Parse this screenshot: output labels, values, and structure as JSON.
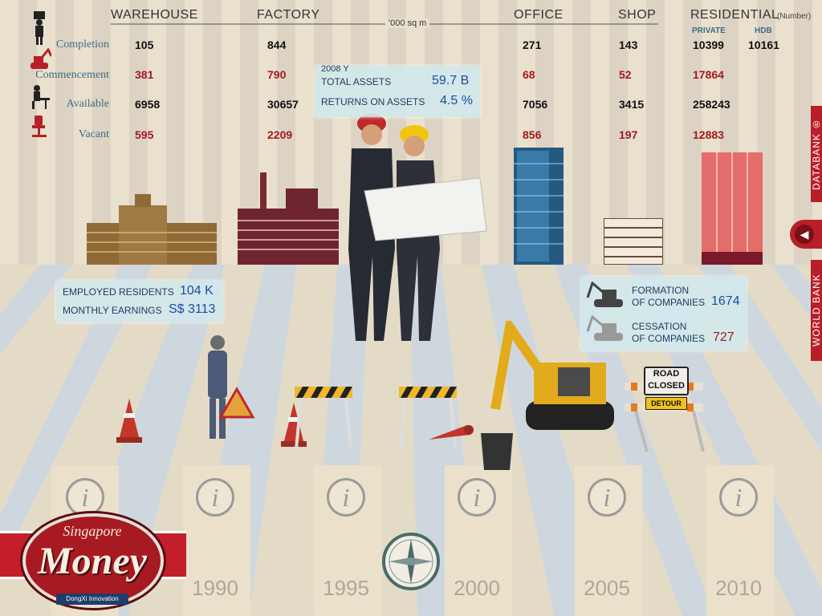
{
  "columns": [
    {
      "key": "warehouse",
      "header": "WAREHOUSE"
    },
    {
      "key": "factory",
      "header": "FACTORY"
    },
    {
      "key": "office",
      "header": "OFFICE"
    },
    {
      "key": "shop",
      "header": "SHOP"
    },
    {
      "key": "residential",
      "header": "RESIDENTIAL",
      "suffix": "(Number)",
      "sub": [
        "PRIVATE",
        "HDB"
      ]
    }
  ],
  "units": "'000 sq m",
  "rows": [
    {
      "label": "Completion",
      "icon": "office-worker-icon",
      "values": [
        "105",
        "844",
        "271",
        "143",
        "10399",
        "10161"
      ],
      "color": "#111"
    },
    {
      "label": "Commencement",
      "icon": "excavator-icon",
      "values": [
        "381",
        "790",
        "68",
        "52",
        "17864"
      ],
      "color": "#a3191f"
    },
    {
      "label": "Available",
      "icon": "desk-worker-icon",
      "values": [
        "6958",
        "30657",
        "7056",
        "3415",
        "258243"
      ],
      "color": "#111"
    },
    {
      "label": "Vacant",
      "icon": "empty-chair-icon",
      "values": [
        "595",
        "2209",
        "856",
        "197",
        "12883"
      ],
      "color": "#a3191f"
    }
  ],
  "assets_panel": {
    "year": "2008 Y",
    "total_assets_label": "TOTAL ASSETS",
    "total_assets": "59.7 B",
    "roa_label": "RETURNS ON ASSETS",
    "roa": "4.5 %"
  },
  "employment_panel": {
    "employed_label": "EMPLOYED RESIDENTS",
    "employed": "104 K",
    "earnings_label": "MONTHLY EARNINGS",
    "earnings": "S$ 3113"
  },
  "companies_panel": {
    "formation_label_1": "FORMATION",
    "formation_label_2": "OF COMPANIES",
    "formation": "1674",
    "cessation_label_1": "CESSATION",
    "cessation_label_2": "OF COMPANIES",
    "cessation": "727"
  },
  "road_sign": {
    "line1": "ROAD",
    "line2": "CLOSED",
    "detour": "DETOUR"
  },
  "timeline": {
    "years": [
      "1990",
      "1995",
      "2000",
      "2005",
      "2010"
    ],
    "info_glyph": "i"
  },
  "side_tabs": {
    "top": "DATABANK ®",
    "bottom": "WORLD BANK"
  },
  "logo": {
    "script": "Singapore",
    "title": "Money",
    "byline": "DongXi Innovation"
  },
  "colors": {
    "accent_red": "#a3191f",
    "label_blue": "#3f6d86",
    "value_blue": "#1a4fa0",
    "stripe": "#e8dcc3"
  }
}
